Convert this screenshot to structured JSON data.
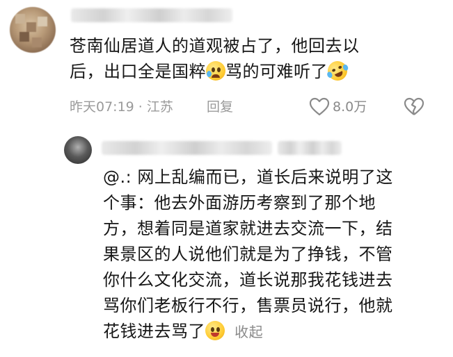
{
  "comment": {
    "text_line1": "苍南仙居道人的道观被占了，他回去以",
    "text_line2_a": "后，出口全是国粹",
    "text_line2_b": "骂的可难听了",
    "time_location": "昨天07:19 · 江苏",
    "reply_label": "回复",
    "like_count": "8.0万",
    "emojis": [
      "worried-face-emoji",
      "rofl-emoji"
    ]
  },
  "reply": {
    "lines": [
      "@.: 网上乱编而已，道长后来说明了这",
      "个事：他去外面游历考察到了那个地",
      "方，想着同是道家就进去交流一下，结",
      "果景区的人说他们就是为了挣钱，不管",
      "你什么文化交流，道长说那我花钱进去",
      "骂你们老板行不行，售票员说行，他就"
    ],
    "last_line": "花钱进去骂了",
    "collapse_label": "收起",
    "emoji": "person-raising-hand-emoji"
  },
  "colors": {
    "text": "#161616",
    "meta": "#9a9a9a",
    "icon": "#8a8a8a"
  }
}
